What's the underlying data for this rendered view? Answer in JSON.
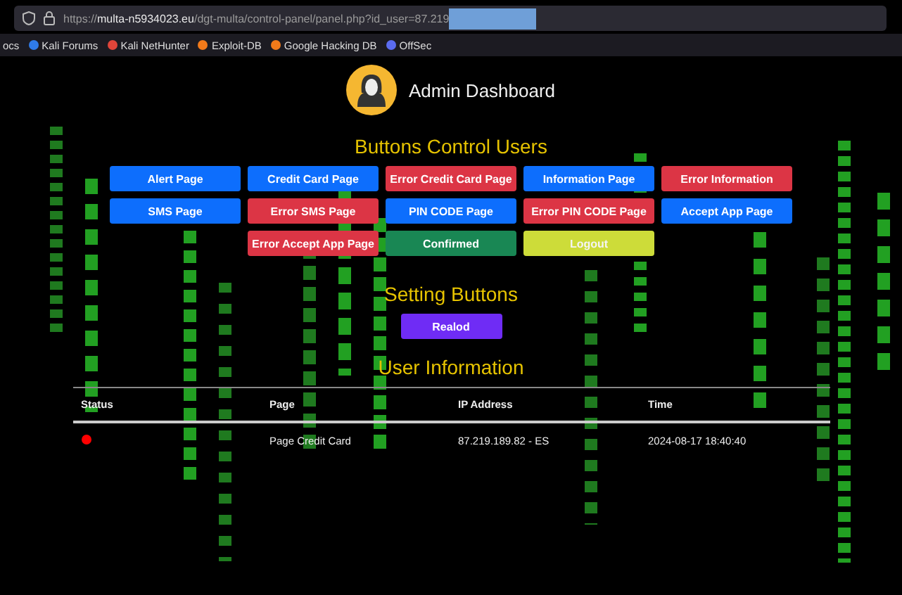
{
  "browser": {
    "url_scheme": "https://",
    "url_host": "multa-n5934023.eu",
    "url_path": "/dgt-multa/control-panel/panel.php?id_user=87.219",
    "bookmarks": [
      "ocs",
      "Kali Forums",
      "Kali NetHunter",
      "Exploit-DB",
      "Google Hacking DB",
      "OffSec"
    ]
  },
  "header": {
    "title": "Admin Dashboard"
  },
  "control_section": {
    "title": "Buttons Control Users",
    "button_rows": [
      [
        {
          "label": "Alert Page",
          "color": "#0d6efd"
        },
        {
          "label": "Credit Card Page",
          "color": "#0d6efd"
        },
        {
          "label": "Error Credit Card Page",
          "color": "#dc3545"
        },
        {
          "label": "Information Page",
          "color": "#0d6efd"
        },
        {
          "label": "Error Information",
          "color": "#dc3545"
        }
      ],
      [
        {
          "label": "SMS Page",
          "color": "#0d6efd"
        },
        {
          "label": "Error SMS Page",
          "color": "#dc3545"
        },
        {
          "label": "PIN CODE Page",
          "color": "#0d6efd"
        },
        {
          "label": "Error PIN CODE Page",
          "color": "#dc3545"
        },
        {
          "label": "Accept App Page",
          "color": "#0d6efd"
        }
      ],
      [
        {
          "label": "Error Accept App Page",
          "color": "#dc3545"
        },
        {
          "label": "Confirmed",
          "color": "#198754"
        },
        {
          "label": "Logout",
          "color": "#cddc39"
        }
      ]
    ]
  },
  "settings_section": {
    "title": "Setting Buttons",
    "buttons": [
      "Realod"
    ]
  },
  "user_info": {
    "title": "User Information",
    "columns": [
      "Status",
      "Page",
      "IP Address",
      "Time"
    ],
    "rows": [
      {
        "color": "#ff0000",
        "page": "Page Credit Card",
        "ip": "87.219.189.82 - ES",
        "time": "2024-08-17 18:40:40"
      }
    ]
  }
}
